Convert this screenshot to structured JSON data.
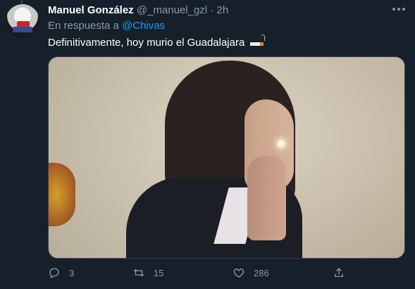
{
  "tweet": {
    "author_name": "Manuel González",
    "handle": "@_manuel_gzl",
    "separator": "·",
    "time": "2h",
    "reply_prefix": "En respuesta a",
    "reply_mention": "@Chivas",
    "text": "Definitivamente, hoy murio el Guadalajara",
    "text_emoji": "smoking-cigarette-emoji"
  },
  "actions": {
    "reply_count": "3",
    "retweet_count": "15",
    "like_count": "286"
  },
  "icons": {
    "more": "more-dots-icon",
    "reply": "reply-icon",
    "retweet": "retweet-icon",
    "like": "heart-icon",
    "share": "share-icon"
  },
  "colors": {
    "background": "#15202b",
    "muted_text": "#8899a6",
    "link": "#1d9bf0",
    "primary_text": "#ffffff"
  }
}
